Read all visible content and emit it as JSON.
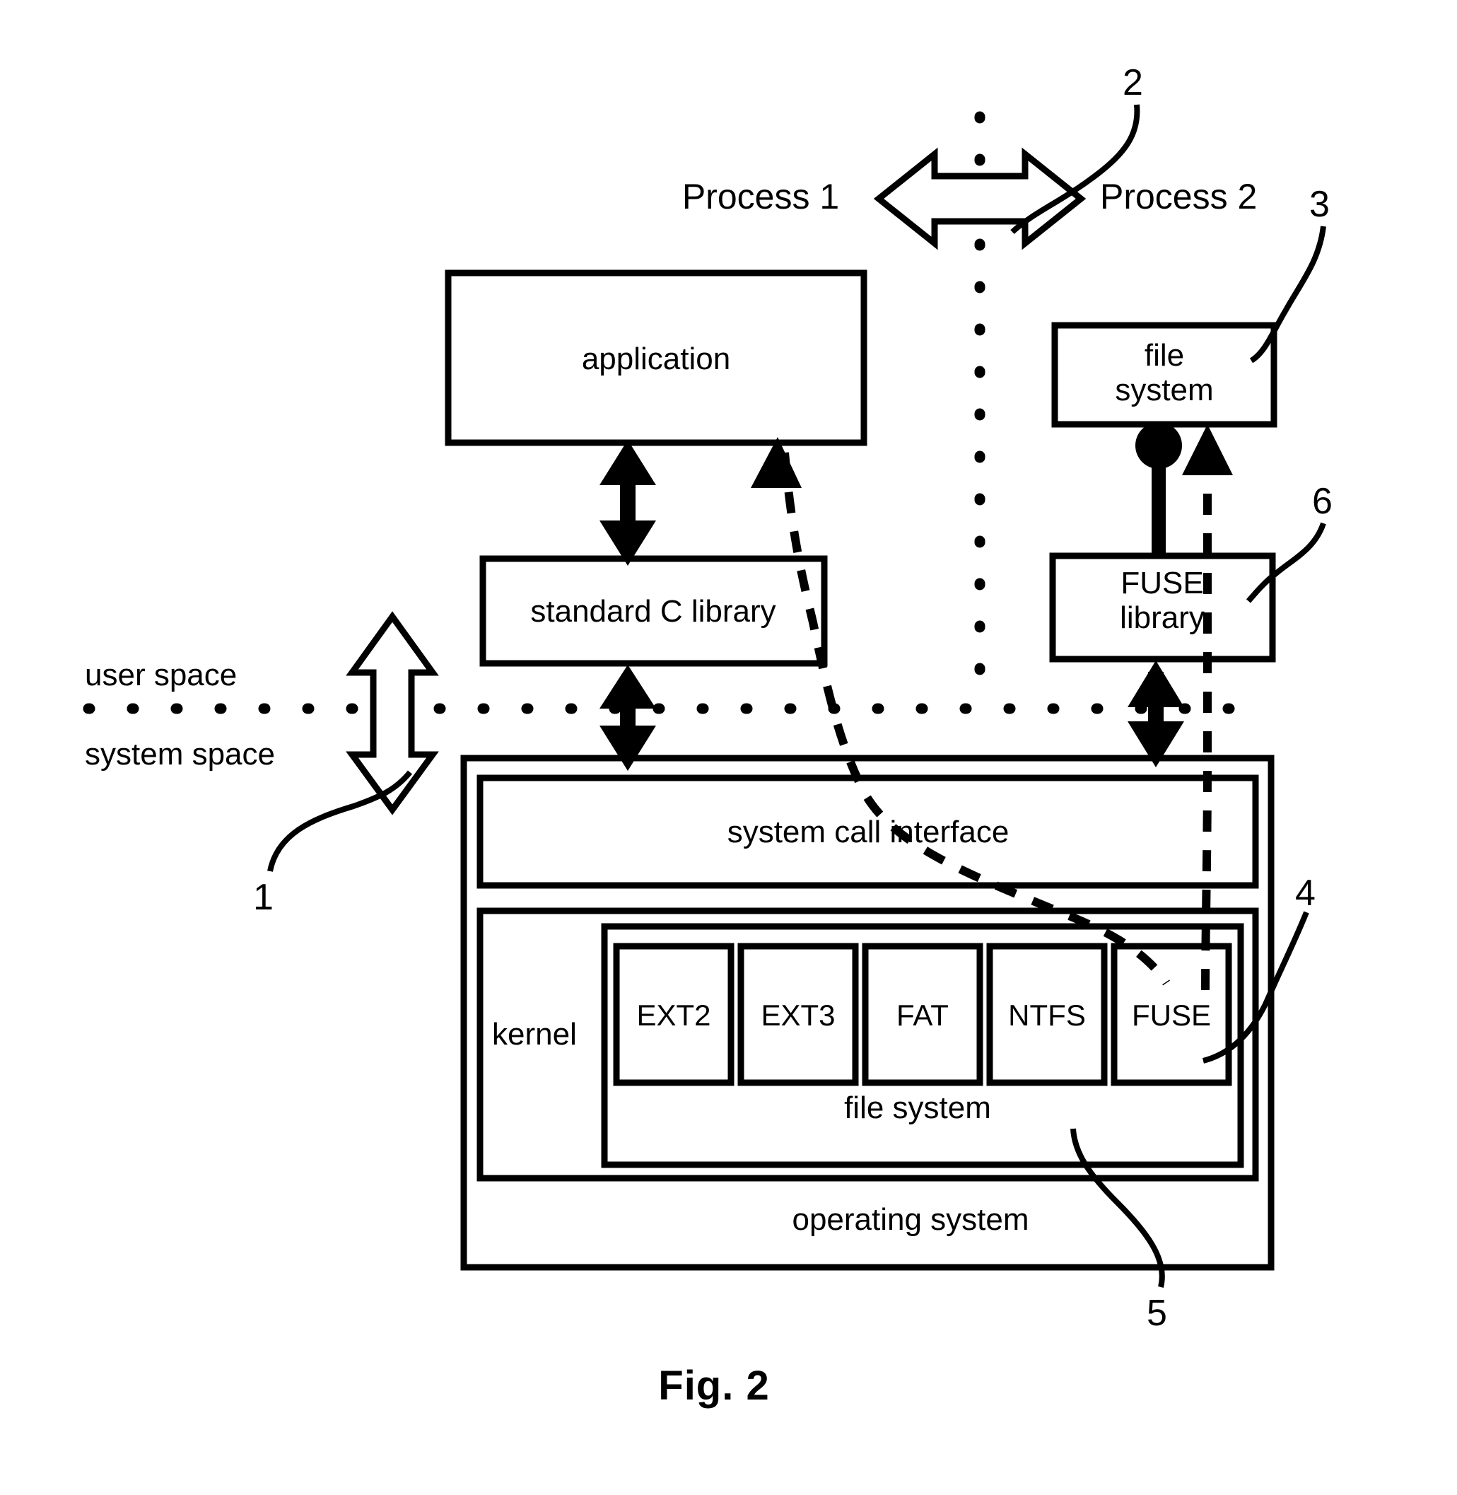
{
  "figure": {
    "caption": "Fig. 2",
    "title_region": "FUSE filesystem architecture diagram"
  },
  "processes": [
    {
      "id": "process1",
      "label": "Process 1"
    },
    {
      "id": "process2",
      "label": "Process 2"
    }
  ],
  "space_labels": {
    "user": "user space",
    "system": "system space"
  },
  "boxes": {
    "application": "application",
    "standard_c_library": "standard C library",
    "file_system_user": "file\nsystem",
    "fuse_library": "FUSE\nlibrary",
    "system_call_interface": "system call interface",
    "kernel": "kernel",
    "file_system_kernel": "file system",
    "operating_system": "operating system"
  },
  "filesystem_modules": [
    "EXT2",
    "EXT3",
    "FAT",
    "NTFS",
    "FUSE"
  ],
  "reference_numerals": [
    {
      "id": "ref-1",
      "label": "1",
      "points_to": "user-system-space-boundary-arrow"
    },
    {
      "id": "ref-2",
      "label": "2",
      "points_to": "process-boundary-arrow"
    },
    {
      "id": "ref-3",
      "label": "3",
      "points_to": "file-system-user-box"
    },
    {
      "id": "ref-4",
      "label": "4",
      "points_to": "fuse-kernel-module"
    },
    {
      "id": "ref-5",
      "label": "5",
      "points_to": "kernel-file-system-box"
    },
    {
      "id": "ref-6",
      "label": "6",
      "points_to": "fuse-library-box"
    }
  ],
  "colors": {
    "ink": "#000000",
    "background": "#ffffff"
  }
}
